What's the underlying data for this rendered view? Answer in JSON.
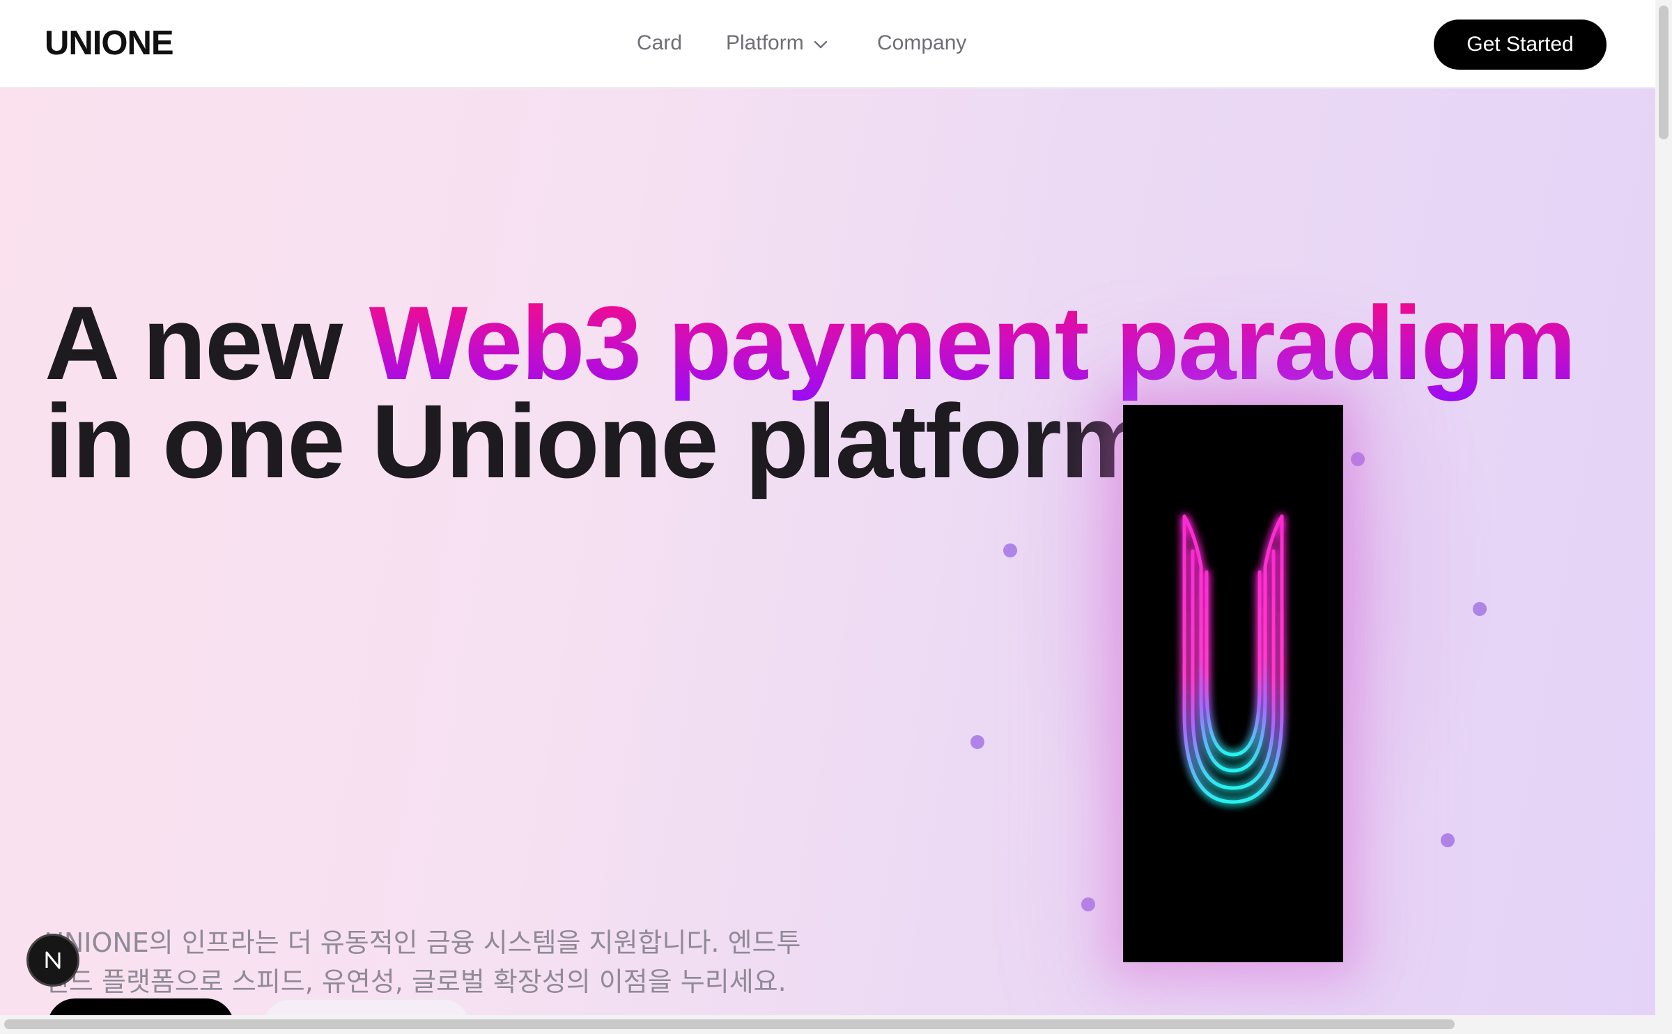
{
  "header": {
    "logo": "UNIONE",
    "nav": [
      {
        "label": "Card"
      },
      {
        "label": "Platform"
      },
      {
        "label": "Company"
      }
    ],
    "cta_label": "Get Started"
  },
  "hero": {
    "headline_part1": "A new ",
    "headline_highlight": "Web3 payment paradigm",
    "headline_part2": "in one Unione platform.",
    "subtitle": "UNIONE의 인프라는 더 유동적인 금융 시스템을 지원합니다. 엔드투엔드 플랫폼으로 스피드, 유연성, 글로벌 확장성의 이점을 누리세요.",
    "badge_letter": "N"
  },
  "colors": {
    "accent_start": "#ff0a78",
    "accent_end": "#9a0cf5",
    "cta_background": "#000000",
    "dot": "#a77be6"
  },
  "icons": {
    "platform_dropdown": "chevron-down-icon",
    "card_logo": "u-neon-logo",
    "badge": "n-badge-icon"
  }
}
